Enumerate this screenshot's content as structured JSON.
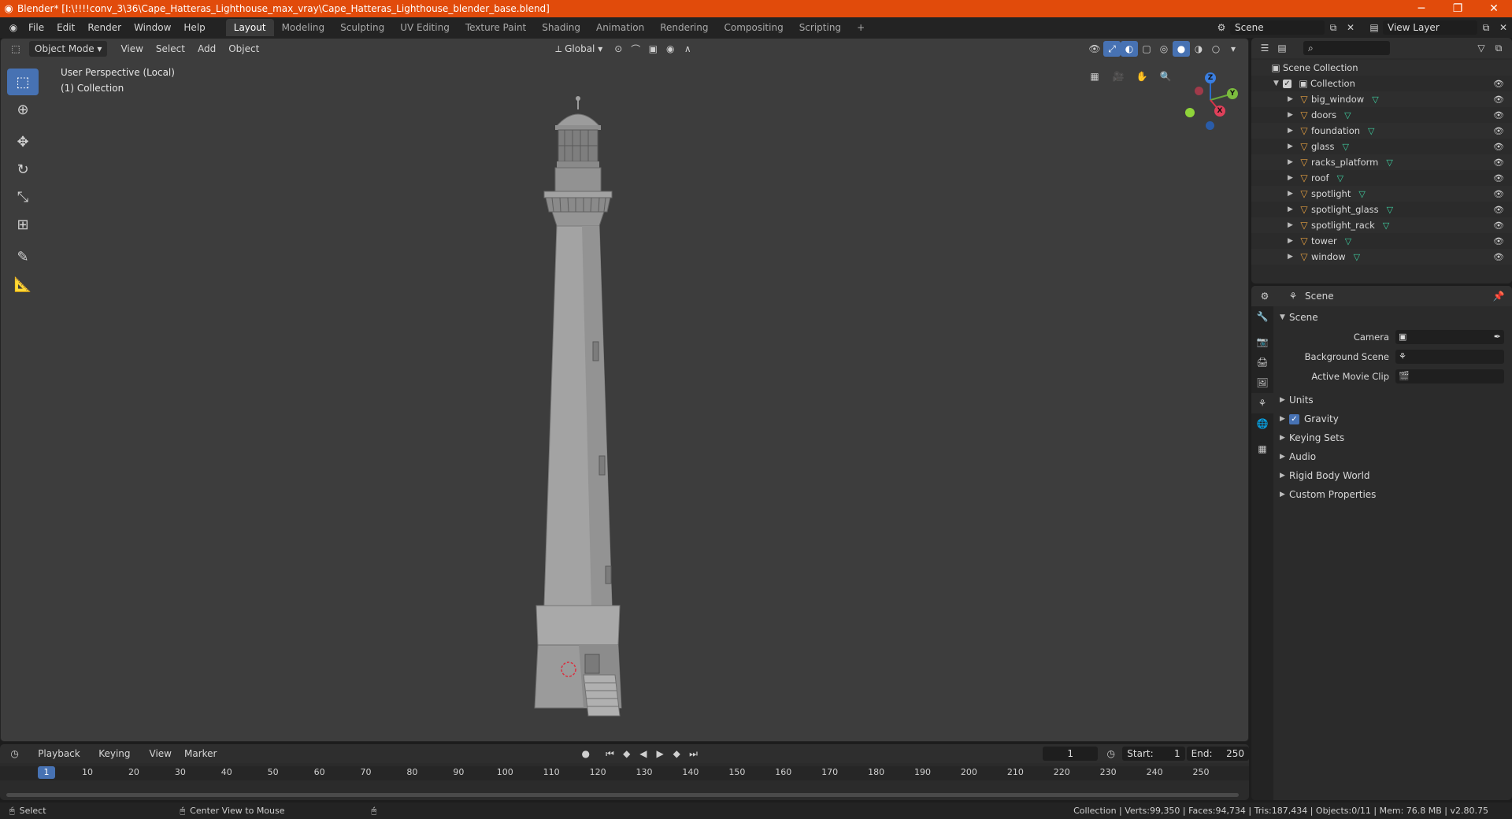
{
  "window": {
    "title": "Blender* [I:\\!!!!conv_3\\36\\Cape_Hatteras_Lighthouse_max_vray\\Cape_Hatteras_Lighthouse_blender_base.blend]",
    "minimize": "─",
    "maximize": "❐",
    "close": "✕"
  },
  "menus": [
    "File",
    "Edit",
    "Render",
    "Window",
    "Help"
  ],
  "workspaces": [
    "Layout",
    "Modeling",
    "Sculpting",
    "UV Editing",
    "Texture Paint",
    "Shading",
    "Animation",
    "Rendering",
    "Compositing",
    "Scripting"
  ],
  "add_workspace": "+",
  "scene_selector": {
    "value": "Scene"
  },
  "view_layer_selector": {
    "value": "View Layer"
  },
  "viewport": {
    "mode": "Object Mode",
    "menus": [
      "View",
      "Select",
      "Add",
      "Object"
    ],
    "orientation": "Global",
    "view_name": "User Perspective (Local)",
    "collection_label": "(1) Collection",
    "gizmo": {
      "z": "Z",
      "y": "Y",
      "x": "X"
    }
  },
  "outliner": {
    "root": "Scene Collection",
    "collection": "Collection",
    "objects": [
      "big_window",
      "doors",
      "foundation",
      "glass",
      "racks_platform",
      "roof",
      "spotlight",
      "spotlight_glass",
      "spotlight_rack",
      "tower",
      "window"
    ]
  },
  "properties": {
    "context": "Scene",
    "panel": "Scene",
    "fields": [
      {
        "label": "Camera"
      },
      {
        "label": "Background Scene"
      },
      {
        "label": "Active Movie Clip"
      }
    ],
    "subpanels": [
      "Units",
      "Gravity",
      "Keying Sets",
      "Audio",
      "Rigid Body World",
      "Custom Properties"
    ],
    "gravity_enabled": true
  },
  "timeline": {
    "menus": [
      "Playback",
      "Keying",
      "View",
      "Marker"
    ],
    "current_frame": "1",
    "start_label": "Start:",
    "start": "1",
    "end_label": "End:",
    "end": "250",
    "ticks": [
      "10",
      "20",
      "30",
      "40",
      "50",
      "60",
      "70",
      "80",
      "90",
      "100",
      "110",
      "120",
      "130",
      "140",
      "150",
      "160",
      "170",
      "180",
      "190",
      "200",
      "210",
      "220",
      "230",
      "240",
      "250"
    ]
  },
  "statusbar": {
    "select": "Select",
    "center_view": "Center View to Mouse",
    "stats": "Collection | Verts:99,350 | Faces:94,734 | Tris:187,434 | Objects:0/11 | Mem: 76.8 MB | v2.80.75"
  },
  "colors": {
    "titlebar": "#e14b0b",
    "accent": "#4772b3",
    "viewport_bg": "#3d3d3d",
    "object_icon": "#e7a040",
    "mesh_icon": "#3fcfa0"
  }
}
